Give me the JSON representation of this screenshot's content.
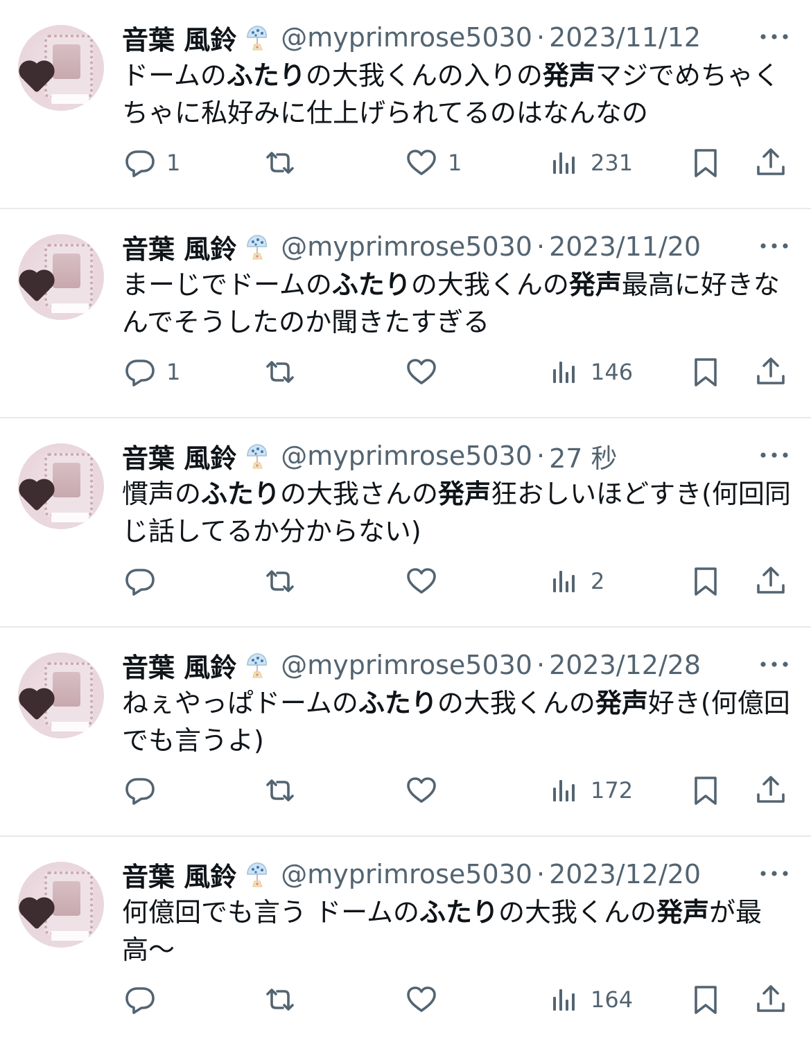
{
  "colors": {
    "text": "#0f1419",
    "secondary": "#536471",
    "divider": "#e7e9ec"
  },
  "icons": {
    "reply": "speech-bubble-icon",
    "retweet": "repost-arrows-icon",
    "like": "heart-icon",
    "views": "bar-chart-icon",
    "bookmark": "bookmark-icon",
    "share": "share-upload-icon",
    "more": "more-dots-icon",
    "badge": "wind-chime-emoji-icon"
  },
  "tweets": [
    {
      "name": "音葉 風鈴",
      "handle": "@myprimrose5030",
      "sep": "·",
      "time": "2023/11/12",
      "text": [
        "ドームの",
        "ふたり",
        "の大我くんの入りの",
        "発声",
        "マジでめちゃくちゃに私好みに仕上げられてるのはなんなの"
      ],
      "replies": "1",
      "retweets": "",
      "likes": "1",
      "views": "231"
    },
    {
      "name": "音葉 風鈴",
      "handle": "@myprimrose5030",
      "sep": "·",
      "time": "2023/11/20",
      "text": [
        "まーじでドームの",
        "ふたり",
        "の大我くんの",
        "発声",
        "最高に好きなんでそうしたのか聞きたすぎる"
      ],
      "replies": "1",
      "retweets": "",
      "likes": "",
      "views": "146"
    },
    {
      "name": "音葉 風鈴",
      "handle": "@myprimrose5030",
      "sep": "·",
      "time": "27 秒",
      "text": [
        "慣声の",
        "ふたり",
        "の大我さんの",
        "発声",
        "狂おしいほどすき(何回同じ話してるか分からない)"
      ],
      "replies": "",
      "retweets": "",
      "likes": "",
      "views": "2"
    },
    {
      "name": "音葉 風鈴",
      "handle": "@myprimrose5030",
      "sep": "·",
      "time": "2023/12/28",
      "text": [
        "ねぇやっぱドームの",
        "ふたり",
        "の大我くんの",
        "発声",
        "好き(何億回でも言うよ)"
      ],
      "replies": "",
      "retweets": "",
      "likes": "",
      "views": "172"
    },
    {
      "name": "音葉 風鈴",
      "handle": "@myprimrose5030",
      "sep": "·",
      "time": "2023/12/20",
      "text": [
        "何億回でも言う ドームの",
        "ふたり",
        "の大我くんの",
        "発声",
        "が最高〜"
      ],
      "replies": "",
      "retweets": "",
      "likes": "",
      "views": "164"
    }
  ]
}
